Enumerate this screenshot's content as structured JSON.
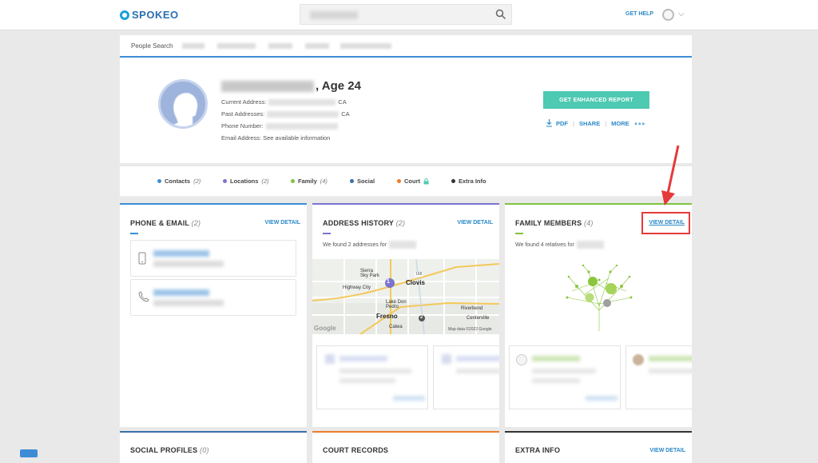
{
  "header": {
    "logo_text": "SPOKEO",
    "get_help": "GET HELP",
    "chevron": "⌵"
  },
  "breadcrumb": {
    "first": "People Search"
  },
  "profile": {
    "name_suffix": ", Age 24",
    "current_address_label": "Current Address:",
    "current_address_state": "CA",
    "past_addresses_label": "Past Addresses:",
    "past_addresses_state": "CA",
    "phone_label": "Phone Number:",
    "email_label": "Email Address:",
    "email_value": "See available information",
    "enhanced_button": "GET ENHANCED REPORT",
    "pdf": "PDF",
    "share": "SHARE",
    "more": "MORE",
    "more_icon": "∘∘∘",
    "sep": "|"
  },
  "legend": [
    {
      "label": "Contacts",
      "count": "(2)",
      "color": "#3d8dd6"
    },
    {
      "label": "Locations",
      "count": "(2)",
      "color": "#7a74d0"
    },
    {
      "label": "Family",
      "count": "(4)",
      "color": "#7fc241"
    },
    {
      "label": "Social",
      "count": "",
      "color": "#3a6fa8"
    },
    {
      "label": "Court",
      "count": "",
      "color": "#f07c28"
    },
    {
      "label": "Extra Info",
      "count": "",
      "color": "#333333"
    }
  ],
  "panels": {
    "phone_email": {
      "title": "PHONE & EMAIL",
      "count": "(2)",
      "view": "VIEW DETAIL"
    },
    "address": {
      "title": "ADDRESS HISTORY",
      "count": "(2)",
      "view": "VIEW DETAIL",
      "found": "We found 2 addresses for"
    },
    "family": {
      "title": "FAMILY MEMBERS",
      "count": "(4)",
      "view": "VIEW DETAIL",
      "found": "We found 4 relatives for"
    },
    "social": {
      "title": "SOCIAL PROFILES",
      "count": "(0)"
    },
    "court": {
      "title": "COURT RECORDS"
    },
    "extra": {
      "title": "EXTRA INFO",
      "view": "VIEW DETAIL"
    }
  },
  "map": {
    "labels": [
      "Sierra\nSky Park",
      "Highway City",
      "Clovis",
      "Lake Don\nPedro",
      "Fresno",
      "Riverbend",
      "Centerville",
      "Calwa"
    ],
    "attribution": "Map data ©2022 Google",
    "google": "Google",
    "pin1": "1",
    "pin2": "2",
    "road": "168"
  },
  "colors": {
    "accent_blue": "#3d8dd6",
    "teal": "#4ec9b2",
    "purple": "#7a74d0",
    "green": "#7fc241",
    "orange": "#f07c28",
    "annotation_red": "#e53a3a"
  }
}
